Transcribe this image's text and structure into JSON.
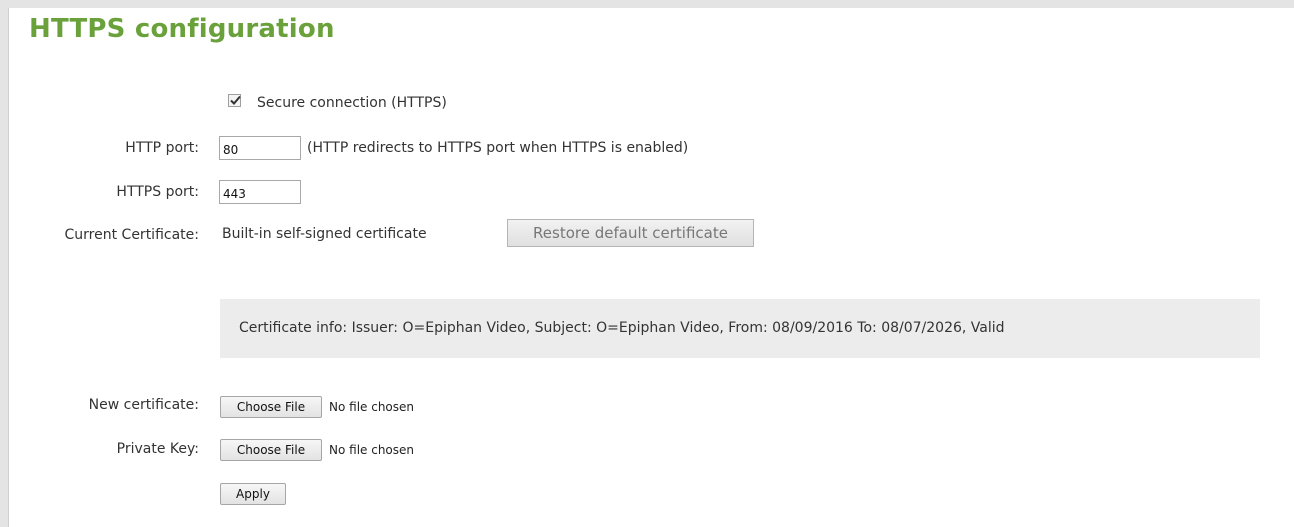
{
  "title": "HTTPS configuration",
  "secure_connection": {
    "label": "Secure connection (HTTPS)",
    "checked": true
  },
  "http_port": {
    "label": "HTTP port:",
    "value": "80",
    "note": "(HTTP redirects to HTTPS port when HTTPS is enabled)"
  },
  "https_port": {
    "label": "HTTPS port:",
    "value": "443"
  },
  "current_certificate": {
    "label": "Current Certificate:",
    "value": "Built-in self-signed certificate",
    "restore_button": "Restore default certificate"
  },
  "certificate_info": "Certificate info: Issuer: O=Epiphan Video, Subject: O=Epiphan Video, From: 08/09/2016 To: 08/07/2026, Valid",
  "new_certificate": {
    "label": "New certificate:",
    "button": "Choose File",
    "status": "No file chosen"
  },
  "private_key": {
    "label": "Private Key:",
    "button": "Choose File",
    "status": "No file chosen"
  },
  "apply_button": "Apply",
  "colors": {
    "title": "#6aa13b",
    "info_background": "#ececec"
  }
}
